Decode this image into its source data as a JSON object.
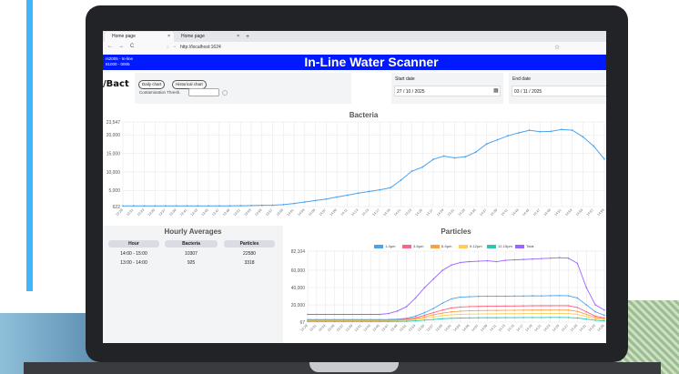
{
  "browser": {
    "tabs": [
      {
        "label": "Home page",
        "close": "×"
      },
      {
        "label": "Home page",
        "close": "×"
      }
    ],
    "new_tab": "+",
    "url": "http://localhost:1624",
    "back": "←",
    "forward": "→",
    "reload": "C"
  },
  "header": {
    "left_line1": "rs2005 - In-line",
    "left_line2": "81000 - 0005",
    "title": "In-Line Water Scanner"
  },
  "controls": {
    "logo": "/Bact",
    "daily_chart": "Daily chart",
    "historical_chart": "Historical chart",
    "contamination_label": "Contamination Thresh.",
    "start_label": "Start date",
    "start_value": "27 / 10 / 2025",
    "end_label": "End date",
    "end_value": "03 / 11 / 2025"
  },
  "colors": {
    "header": "#0019ff",
    "bacteria_line": "#4aa3ef",
    "accent": "#3fb6f6"
  },
  "hourly": {
    "title": "Hourly Averages",
    "columns": [
      "Hour",
      "Bacteria",
      "Particles"
    ],
    "rows": [
      [
        "14:00 - 15:00",
        "10307",
        "22580"
      ],
      [
        "13:00 - 14:00",
        "925",
        "3318"
      ]
    ]
  },
  "chart_data": [
    {
      "type": "line",
      "title": "Bacteria",
      "yticks": [
        "23,547",
        "20,000",
        "15,000",
        "10,000",
        "5,000",
        "622"
      ],
      "ylim": [
        622,
        23547
      ],
      "grid": true,
      "x": [
        "13:29",
        "13:31",
        "13:33",
        "13:35",
        "13:37",
        "13:39",
        "13:41",
        "13:43",
        "13:45",
        "13:47",
        "13:49",
        "13:51",
        "13:53",
        "13:55",
        "13:57",
        "13:59",
        "14:01",
        "14:03",
        "14:05",
        "14:07",
        "14:09",
        "14:11",
        "14:13",
        "14:15",
        "14:17",
        "14:19",
        "14:21",
        "14:23",
        "14:25",
        "14:27",
        "14:29",
        "14:31",
        "14:33",
        "14:35",
        "14:37",
        "14:39",
        "14:41",
        "14:43",
        "14:45",
        "14:47",
        "14:49",
        "14:51",
        "14:53",
        "14:55",
        "14:57",
        "14:59"
      ],
      "series": [
        {
          "values": [
            800,
            800,
            800,
            800,
            800,
            800,
            800,
            800,
            800,
            800,
            820,
            850,
            900,
            950,
            1000,
            1150,
            1450,
            1850,
            2250,
            2650,
            3200,
            3700,
            4250,
            4700,
            5150,
            5700,
            7800,
            10200,
            11300,
            13400,
            14300,
            13800,
            14100,
            15400,
            17600,
            18700,
            19800,
            20600,
            21300,
            20900,
            21000,
            21500,
            21300,
            19500,
            17000,
            13500
          ]
        }
      ]
    },
    {
      "type": "line",
      "title": "Particles",
      "yticks": [
        "82,104",
        "60,000",
        "40,000",
        "20,000",
        "67"
      ],
      "ylim": [
        67,
        82104
      ],
      "grid": true,
      "x": [
        "13:29",
        "13:31",
        "13:33",
        "13:35",
        "13:37",
        "13:39",
        "13:41",
        "13:43",
        "13:45",
        "13:47",
        "13:49",
        "13:51",
        "13:53",
        "13:55",
        "13:57",
        "13:59",
        "14:01",
        "14:03",
        "14:05",
        "14:07",
        "14:09",
        "14:11",
        "14:13",
        "14:15",
        "14:17",
        "14:19",
        "14:21",
        "14:23",
        "14:25",
        "14:27",
        "14:29",
        "14:31",
        "14:33",
        "14:35"
      ],
      "series": [
        {
          "name": "1-3µm",
          "color": "#4aa3ef",
          "values": [
            3000,
            3000,
            3000,
            3000,
            3000,
            3000,
            3000,
            3000,
            3000,
            3100,
            3500,
            4500,
            7000,
            11000,
            16000,
            22000,
            27000,
            29000,
            29500,
            29800,
            30000,
            30000,
            30000,
            30200,
            30200,
            30500,
            30400,
            30600,
            30800,
            30500,
            28000,
            20000,
            12000,
            8000
          ]
        },
        {
          "name": "3-6µm",
          "color": "#ff6384",
          "values": [
            2500,
            2500,
            2500,
            2500,
            2500,
            2500,
            2500,
            2500,
            2500,
            2600,
            2900,
            3500,
            5000,
            8000,
            11000,
            14000,
            16500,
            17500,
            18000,
            18200,
            18400,
            18500,
            18600,
            18700,
            18800,
            18900,
            19000,
            19000,
            19100,
            19000,
            17000,
            12000,
            7000,
            5000
          ]
        },
        {
          "name": "6-9µm",
          "color": "#ff9f40",
          "values": [
            2000,
            2000,
            2000,
            2000,
            2000,
            2000,
            2000,
            2000,
            2000,
            2100,
            2300,
            2800,
            4000,
            6000,
            8500,
            10500,
            12000,
            12800,
            13200,
            13400,
            13500,
            13600,
            13700,
            13800,
            13900,
            14000,
            14000,
            14100,
            14100,
            14000,
            12500,
            9000,
            5500,
            4000
          ]
        },
        {
          "name": "9-12µm",
          "color": "#ffcd56",
          "values": [
            1500,
            1500,
            1500,
            1500,
            1500,
            1500,
            1500,
            1500,
            1500,
            1600,
            1800,
            2100,
            3000,
            4500,
            6000,
            7500,
            8500,
            9000,
            9300,
            9500,
            9600,
            9700,
            9800,
            9800,
            9900,
            10000,
            10000,
            10000,
            10100,
            10000,
            9000,
            6500,
            4000,
            3000
          ]
        },
        {
          "name": "12-15µm",
          "color": "#2ec4b6",
          "values": [
            800,
            800,
            800,
            800,
            800,
            800,
            800,
            800,
            800,
            850,
            950,
            1100,
            1600,
            2400,
            3200,
            4000,
            4500,
            4800,
            5000,
            5100,
            5200,
            5200,
            5300,
            5300,
            5400,
            5400,
            5400,
            5500,
            5500,
            5400,
            4900,
            3500,
            2200,
            1500
          ]
        },
        {
          "name": "Total",
          "color": "#9966ff",
          "values": [
            9000,
            9000,
            9000,
            9000,
            9000,
            9000,
            9000,
            9000,
            9000,
            10000,
            13000,
            18000,
            28000,
            40000,
            50000,
            60000,
            66000,
            69000,
            70000,
            70500,
            71000,
            70000,
            71500,
            72000,
            72500,
            73000,
            73500,
            74000,
            74500,
            74000,
            68000,
            40000,
            20000,
            14000
          ]
        }
      ]
    }
  ]
}
